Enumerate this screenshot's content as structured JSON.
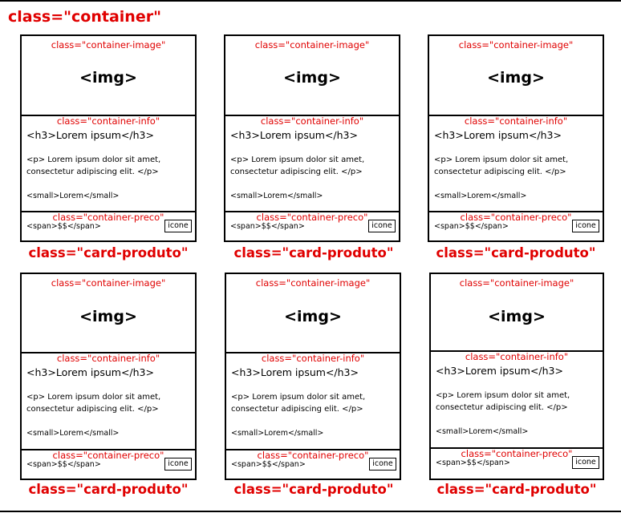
{
  "container_label": "class=\"container\"",
  "cards": [
    {
      "container_image_label": "class=\"container-image\"",
      "img_text": "<img>",
      "container_info_label": "class=\"container-info\"",
      "h3_text": "<h3>Lorem ipsum</h3>",
      "p_text": "<p> Lorem ipsum dolor sit amet, consectetur adipiscing elit. </p>",
      "small_text": "<small>Lorem</small>",
      "container_preco_label": "class=\"container-preco\"",
      "span_text": "<span>$$</span>",
      "icone_text": "icone",
      "card_label": "class=\"card-produto\""
    },
    {
      "container_image_label": "class=\"container-image\"",
      "img_text": "<img>",
      "container_info_label": "class=\"container-info\"",
      "h3_text": "<h3>Lorem ipsum</h3>",
      "p_text": "<p> Lorem ipsum dolor sit amet, consectetur adipiscing elit. </p>",
      "small_text": "<small>Lorem</small>",
      "container_preco_label": "class=\"container-preco\"",
      "span_text": "<span>$$</span>",
      "icone_text": "icone",
      "card_label": "class=\"card-produto\""
    },
    {
      "container_image_label": "class=\"container-image\"",
      "img_text": "<img>",
      "container_info_label": "class=\"container-info\"",
      "h3_text": "<h3>Lorem ipsum</h3>",
      "p_text": "<p> Lorem ipsum dolor sit amet, consectetur adipiscing elit. </p>",
      "small_text": "<small>Lorem</small>",
      "container_preco_label": "class=\"container-preco\"",
      "span_text": "<span>$$</span>",
      "icone_text": "icone",
      "card_label": "class=\"card-produto\""
    },
    {
      "container_image_label": "class=\"container-image\"",
      "img_text": "<img>",
      "container_info_label": "class=\"container-info\"",
      "h3_text": "<h3>Lorem ipsum</h3>",
      "p_text": "<p> Lorem ipsum dolor sit amet, consectetur adipiscing elit. </p>",
      "small_text": "<small>Lorem</small>",
      "container_preco_label": "class=\"container-preco\"",
      "span_text": "<span>$$</span>",
      "icone_text": "icone",
      "card_label": "class=\"card-produto\""
    },
    {
      "container_image_label": "class=\"container-image\"",
      "img_text": "<img>",
      "container_info_label": "class=\"container-info\"",
      "h3_text": "<h3>Lorem ipsum</h3>",
      "p_text": "<p> Lorem ipsum dolor sit amet, consectetur adipiscing elit. </p>",
      "small_text": "<small>Lorem</small>",
      "container_preco_label": "class=\"container-preco\"",
      "span_text": "<span>$$</span>",
      "icone_text": "icone",
      "card_label": "class=\"card-produto\""
    },
    {
      "container_image_label": "class=\"container-image\"",
      "img_text": "<img>",
      "container_info_label": "class=\"container-info\"",
      "h3_text": "<h3>Lorem ipsum</h3>",
      "p_text": "<p> Lorem ipsum dolor sit amet, consectetur adipiscing elit. </p>",
      "small_text": "<small>Lorem</small>",
      "container_preco_label": "class=\"container-preco\"",
      "span_text": "<span>$$</span>",
      "icone_text": "icone",
      "card_label": "class=\"card-produto\""
    }
  ]
}
